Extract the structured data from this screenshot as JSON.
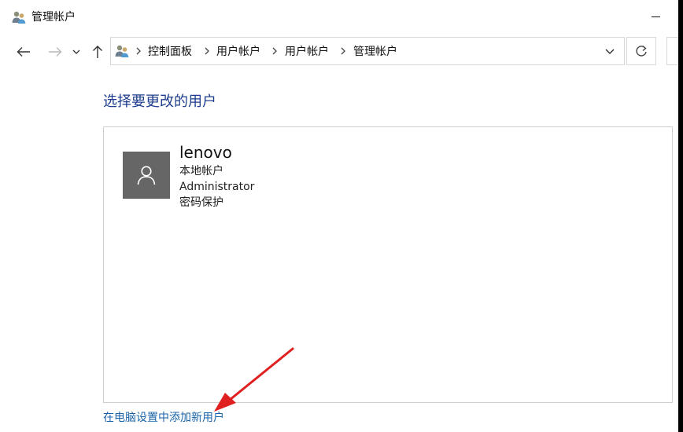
{
  "window": {
    "title": "管理帐户",
    "icon": "users-icon"
  },
  "nav": {
    "back_icon": "arrow-left-icon",
    "forward_icon": "arrow-right-icon",
    "recent_icon": "chevron-down-icon",
    "up_icon": "arrow-up-icon",
    "breadcrumbs": [
      "控制面板",
      "用户帐户",
      "用户帐户",
      "管理帐户"
    ],
    "refresh_icon": "refresh-icon"
  },
  "main": {
    "heading": "选择要更改的用户",
    "users": [
      {
        "name": "lenovo",
        "type": "本地帐户",
        "role": "Administrator",
        "protection": "密码保护"
      }
    ],
    "add_user_link": "在电脑设置中添加新用户"
  },
  "colors": {
    "heading": "#1e3d8f",
    "link": "#1a63a8",
    "avatar_bg": "#666666",
    "annotation_arrow": "#e02020"
  }
}
